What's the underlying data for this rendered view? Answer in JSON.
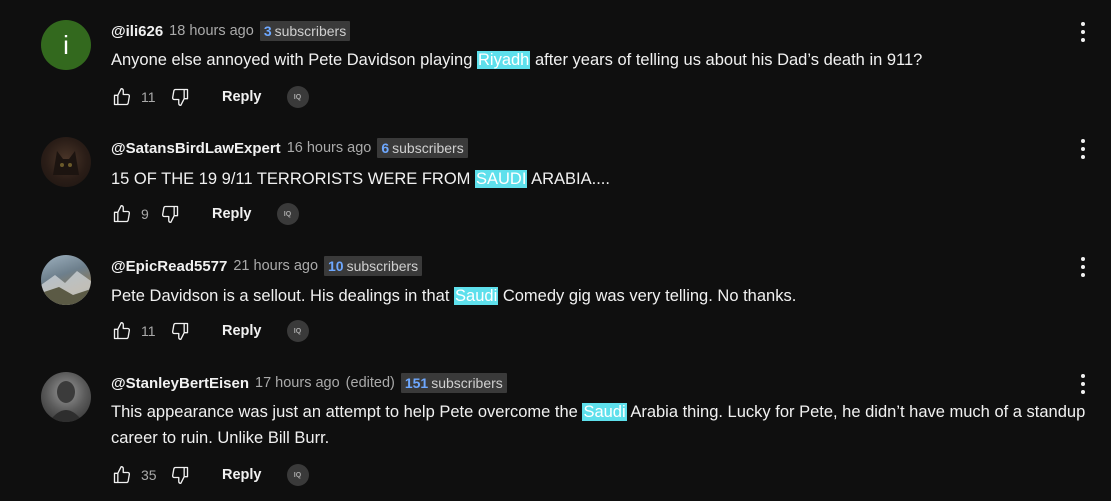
{
  "comments": [
    {
      "avatar_letter": "i",
      "avatar_color": "#33691e",
      "handle": "@ili626",
      "time": "18 hours ago",
      "edited": "",
      "subs_count": "3",
      "subs_label": "subscribers",
      "text_before": "Anyone else annoyed with Pete Davidson playing ",
      "highlight": "Riyadh",
      "text_after": " after years of telling us about his Dad’s death in 911?",
      "likes": "11",
      "reply_label": "Reply"
    },
    {
      "avatar_letter": "",
      "avatar_color": "#3a2a22",
      "handle": "@SatansBirdLawExpert",
      "time": "16 hours ago",
      "edited": "",
      "subs_count": "6",
      "subs_label": "subscribers",
      "text_before": "15 OF THE 19 9/11 TERRORISTS WERE FROM ",
      "highlight": "SAUDI",
      "text_after": " ARABIA....",
      "likes": "9",
      "reply_label": "Reply"
    },
    {
      "avatar_letter": "",
      "avatar_color": "#6b7b86",
      "handle": "@EpicRead5577",
      "time": "21 hours ago",
      "edited": "",
      "subs_count": "10",
      "subs_label": "subscribers",
      "text_before": "Pete Davidson is a sellout. His dealings in that ",
      "highlight": "Saudi",
      "text_after": " Comedy gig was very telling. No thanks.",
      "likes": "11",
      "reply_label": "Reply"
    },
    {
      "avatar_letter": "",
      "avatar_color": "#5a5a5a",
      "handle": "@StanleyBertEisen",
      "time": "17 hours ago",
      "edited": "(edited)",
      "subs_count": "151",
      "subs_label": "subscribers",
      "text_before": "This appearance was just an attempt to help Pete overcome the ",
      "highlight": "Saudi",
      "text_after": " Arabia thing.  Lucky for Pete, he didn’t have much of a standup career to ruin.  Unlike Bill Burr.",
      "likes": "35",
      "reply_label": "Reply"
    }
  ],
  "icons": {
    "like": "thumbs-up-icon",
    "dislike": "thumbs-down-icon",
    "extension": "iq-extension-icon",
    "menu": "more-vertical-icon",
    "extension_text": "IQ"
  },
  "colors": {
    "background": "#0f0f0f",
    "highlight": "#5ee0ec",
    "subs_number": "#6ea8ff"
  }
}
